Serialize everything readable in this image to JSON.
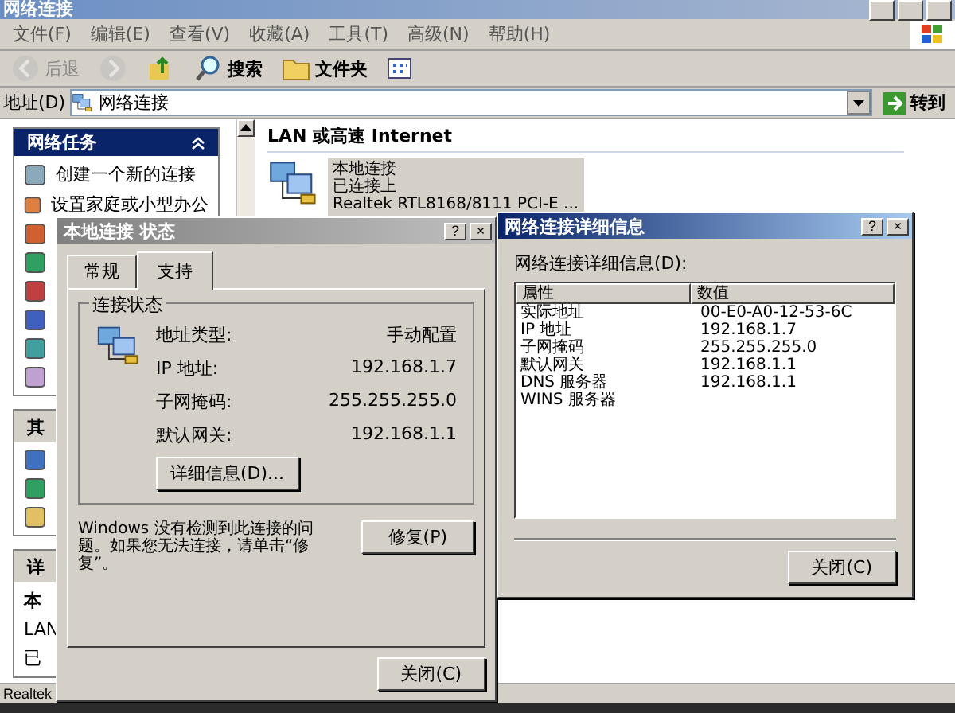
{
  "window": {
    "title": "网络连接"
  },
  "menu": [
    "文件(F)",
    "编辑(E)",
    "查看(V)",
    "收藏(A)",
    "工具(T)",
    "高级(N)",
    "帮助(H)"
  ],
  "toolbar": [
    {
      "kind": "back",
      "label": "后退",
      "disabled": true
    },
    {
      "kind": "forward",
      "disabled": true
    },
    {
      "kind": "up",
      "disabled": false
    },
    {
      "kind": "search",
      "label": "搜索",
      "disabled": false
    },
    {
      "kind": "folders",
      "label": "文件夹",
      "disabled": false
    },
    {
      "kind": "views",
      "disabled": false
    }
  ],
  "address": {
    "label": "地址(D)",
    "value": "网络连接",
    "go": "转到"
  },
  "sidebar": {
    "tasks": {
      "title": "网络任务",
      "expanded": true,
      "items": [
        "创建一个新的连接",
        "设置家庭或小型办公"
      ]
    },
    "other_title": "其",
    "details_title": "详",
    "details_name": "本",
    "details_lines": [
      "LAN",
      "已"
    ]
  },
  "content": {
    "group": "LAN 或高速 Internet",
    "connections": [
      {
        "name": "本地连接",
        "status": "已连接上",
        "device": "Realtek RTL8168/8111 PCI-E ...",
        "selected": true
      }
    ]
  },
  "status_bar": "Realtek",
  "status_dialog": {
    "title": "本地连接 状态",
    "tabs": [
      {
        "label": "常规",
        "selected": false
      },
      {
        "label": "支持",
        "selected": true
      }
    ],
    "group": "连接状态",
    "fields": [
      {
        "label": "地址类型:",
        "value": "手动配置"
      },
      {
        "label": "IP 地址:",
        "value": "192.168.1.7"
      },
      {
        "label": "子网掩码:",
        "value": "255.255.255.0"
      },
      {
        "label": "默认网关:",
        "value": "192.168.1.1"
      }
    ],
    "details_button": "详细信息(D)...",
    "message": "Windows 没有检测到此连接的问题。如果您无法连接，请单击“修复”。",
    "repair_button": "修复(P)",
    "close_button": "关闭(C)",
    "help": "?",
    "close": "×"
  },
  "details_dialog": {
    "title": "网络连接详细信息",
    "label": "网络连接详细信息(D):",
    "columns": [
      "属性",
      "数值"
    ],
    "rows": [
      {
        "property": "实际地址",
        "value": "00-E0-A0-12-53-6C"
      },
      {
        "property": "IP 地址",
        "value": "192.168.1.7"
      },
      {
        "property": "子网掩码",
        "value": "255.255.255.0"
      },
      {
        "property": "默认网关",
        "value": "192.168.1.1"
      },
      {
        "property": "DNS 服务器",
        "value": "192.168.1.1"
      },
      {
        "property": "WINS 服务器"
      }
    ],
    "close_button": "关闭(C)",
    "help": "?",
    "close": "×"
  }
}
